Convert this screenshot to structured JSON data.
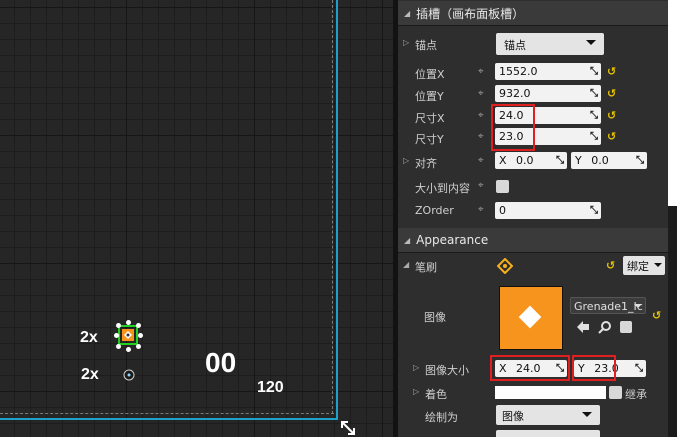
{
  "viewport": {
    "label_2x_a": "2x",
    "label_2x_b": "2x",
    "label_00": "00",
    "label_120": "120"
  },
  "panel": {
    "slot_section": "插槽（画布面板槽）",
    "anchors": {
      "label": "锚点",
      "value": "锚点"
    },
    "pos_x": {
      "label": "位置X",
      "value": "1552.0"
    },
    "pos_y": {
      "label": "位置Y",
      "value": "932.0"
    },
    "size_x": {
      "label": "尺寸X",
      "value": "24.0"
    },
    "size_y": {
      "label": "尺寸Y",
      "value": "23.0"
    },
    "alignment": {
      "label": "对齐",
      "x_prefix": "X",
      "x_value": "0.0",
      "y_prefix": "Y",
      "y_value": "0.0"
    },
    "size_to_content": {
      "label": "大小到内容"
    },
    "zorder": {
      "label": "ZOrder",
      "value": "0"
    },
    "appearance_section": "Appearance",
    "brush": {
      "label": "笔刷",
      "bind_label": "绑定"
    },
    "image": {
      "label": "图像",
      "asset": "Grenade1_Ic"
    },
    "image_size": {
      "label": "图像大小",
      "x_prefix": "X",
      "x_value": "24.0",
      "y_prefix": "Y",
      "y_value": "23.0"
    },
    "tint": {
      "label": "着色",
      "inherit_label": "继承"
    },
    "draw_as": {
      "label": "绘制为",
      "value": "图像"
    }
  },
  "colors": {
    "accent": "#1fa0c8",
    "highlight": "#e02020",
    "brush": "#f7941d",
    "selection": "#21d021"
  }
}
